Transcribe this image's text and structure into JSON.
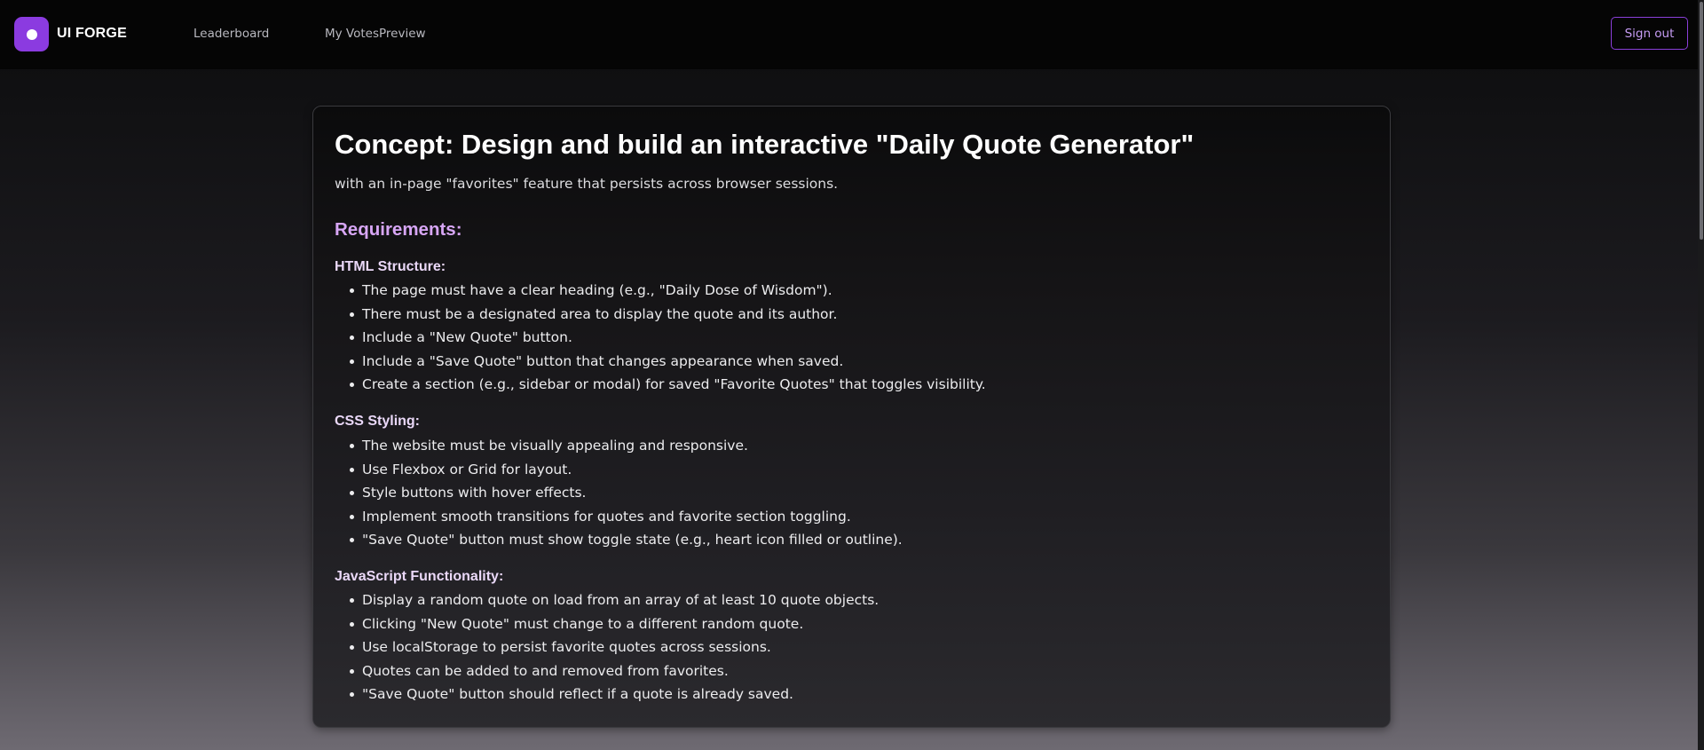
{
  "header": {
    "brand": "UI FORGE",
    "nav": [
      {
        "label": "Leaderboard"
      },
      {
        "label": "My VotesPreview"
      }
    ],
    "sign_out_label": "Sign out"
  },
  "content": {
    "title": "Concept: Design and build an interactive \"Daily Quote Generator\"",
    "subtitle": "with an in-page \"favorites\" feature that persists across browser sessions.",
    "requirements_heading": "Requirements:",
    "sections": [
      {
        "title": "HTML Structure:",
        "items": [
          "The page must have a clear heading (e.g., \"Daily Dose of Wisdom\").",
          "There must be a designated area to display the quote and its author.",
          "Include a \"New Quote\" button.",
          "Include a \"Save Quote\" button that changes appearance when saved.",
          "Create a section (e.g., sidebar or modal) for saved \"Favorite Quotes\" that toggles visibility."
        ]
      },
      {
        "title": "CSS Styling:",
        "items": [
          "The website must be visually appealing and responsive.",
          "Use Flexbox or Grid for layout.",
          "Style buttons with hover effects.",
          "Implement smooth transitions for quotes and favorite section toggling.",
          "\"Save Quote\" button must show toggle state (e.g., heart icon filled or outline)."
        ]
      },
      {
        "title": "JavaScript Functionality:",
        "items": [
          "Display a random quote on load from an array of at least 10 quote objects.",
          "Clicking \"New Quote\" must change to a different random quote.",
          "Use localStorage to persist favorite quotes across sessions.",
          "Quotes can be added to and removed from favorites.",
          "\"Save Quote\" button should reflect if a quote is already saved."
        ]
      }
    ]
  },
  "colors": {
    "accent": "#8b3be0",
    "heading_accent": "#d7a6f5"
  }
}
